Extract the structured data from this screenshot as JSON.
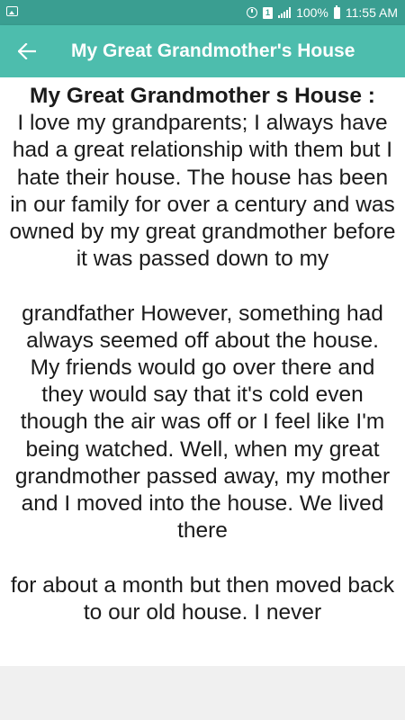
{
  "status_bar": {
    "battery": "100%",
    "time": "11:55 AM",
    "sim_label": "1"
  },
  "app_bar": {
    "title": "My Great Grandmother's House",
    "back_icon": "arrow-left-icon"
  },
  "article": {
    "heading": "My Great Grandmother s House :",
    "paragraph_1": "I love my grandparents; I always have had a great relationship with them but I hate their house. The house has been in our family for over a century and was owned by my great grandmother before it was passed down to my",
    "paragraph_2": "grandfather However, something had always seemed off about the house. My friends would go over there and they would say that it's cold even though the air was off or I feel like I'm being watched. Well, when my great grandmother passed away, my mother and I moved into the house. We lived there",
    "paragraph_3": "for about a month but then moved back to our old house. I never"
  },
  "colors": {
    "status_bar": "#3a9e91",
    "app_bar": "#4dbdad",
    "text": "#1b1b1b"
  }
}
